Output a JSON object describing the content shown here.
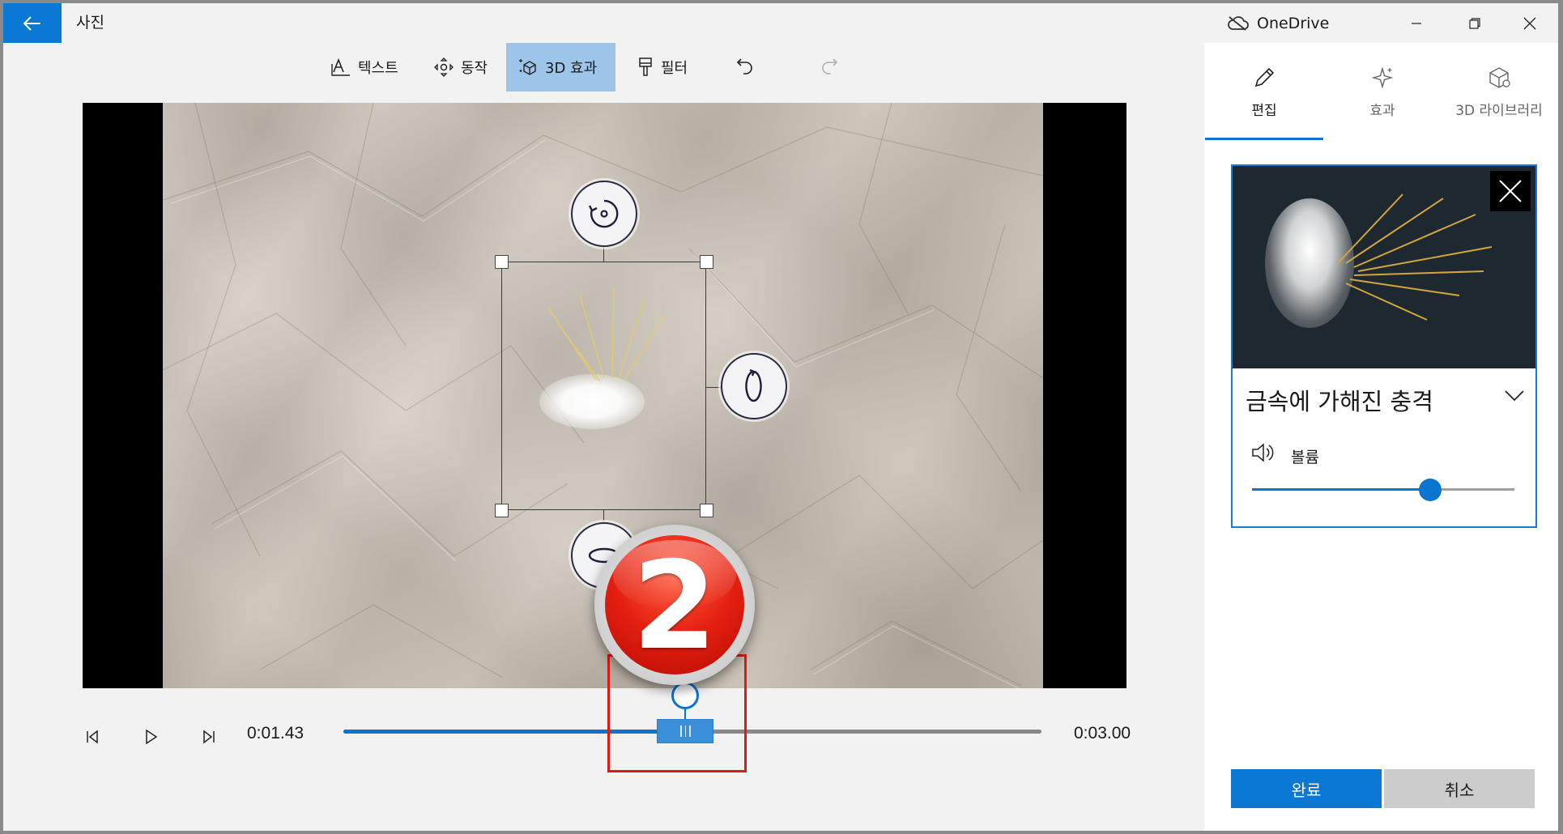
{
  "titlebar": {
    "app_title": "사진",
    "onedrive_label": "OneDrive"
  },
  "toolbar": {
    "text_label": "텍스트",
    "motion_label": "동작",
    "effects3d_label": "3D 효과",
    "filter_label": "필터"
  },
  "playback": {
    "current_time": "0:01.43",
    "total_time": "0:03.00",
    "progress": 0.49
  },
  "annotation": {
    "step_number": "2"
  },
  "panel": {
    "tabs": [
      {
        "label": "편집",
        "icon": "pencil-icon",
        "active": true
      },
      {
        "label": "효과",
        "icon": "sparkle-icon",
        "active": false
      },
      {
        "label": "3D 라이브러리",
        "icon": "cube-icon",
        "active": false
      }
    ],
    "effect_name": "금속에 가해진 충격",
    "volume_label": "볼륨",
    "volume_level": 0.68,
    "done_label": "완료",
    "cancel_label": "취소"
  },
  "colors": {
    "accent": "#0a78d4",
    "toolbar_active": "#9dc5ea",
    "annotation_red": "#e01818"
  }
}
